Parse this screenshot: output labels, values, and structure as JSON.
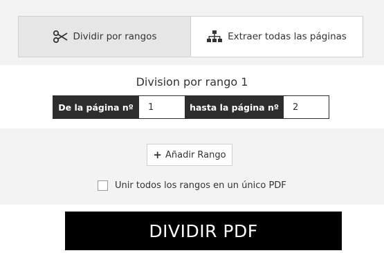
{
  "tabs": [
    {
      "label": "Dividir por rangos",
      "icon": "scissors-icon",
      "active": true
    },
    {
      "label": "Extraer todas las páginas",
      "icon": "sitemap-icon",
      "active": false
    }
  ],
  "range": {
    "title": "Division por rango 1",
    "from_label": "De la página nº",
    "from_value": "1",
    "to_label": "hasta la página nº",
    "to_value": "2"
  },
  "add_range": {
    "label": "Añadir Rango",
    "icon": "plus-icon"
  },
  "merge": {
    "label": "Unir todos los rangos en un único PDF",
    "checked": false
  },
  "split_button": {
    "label": "DIVIDIR PDF"
  }
}
